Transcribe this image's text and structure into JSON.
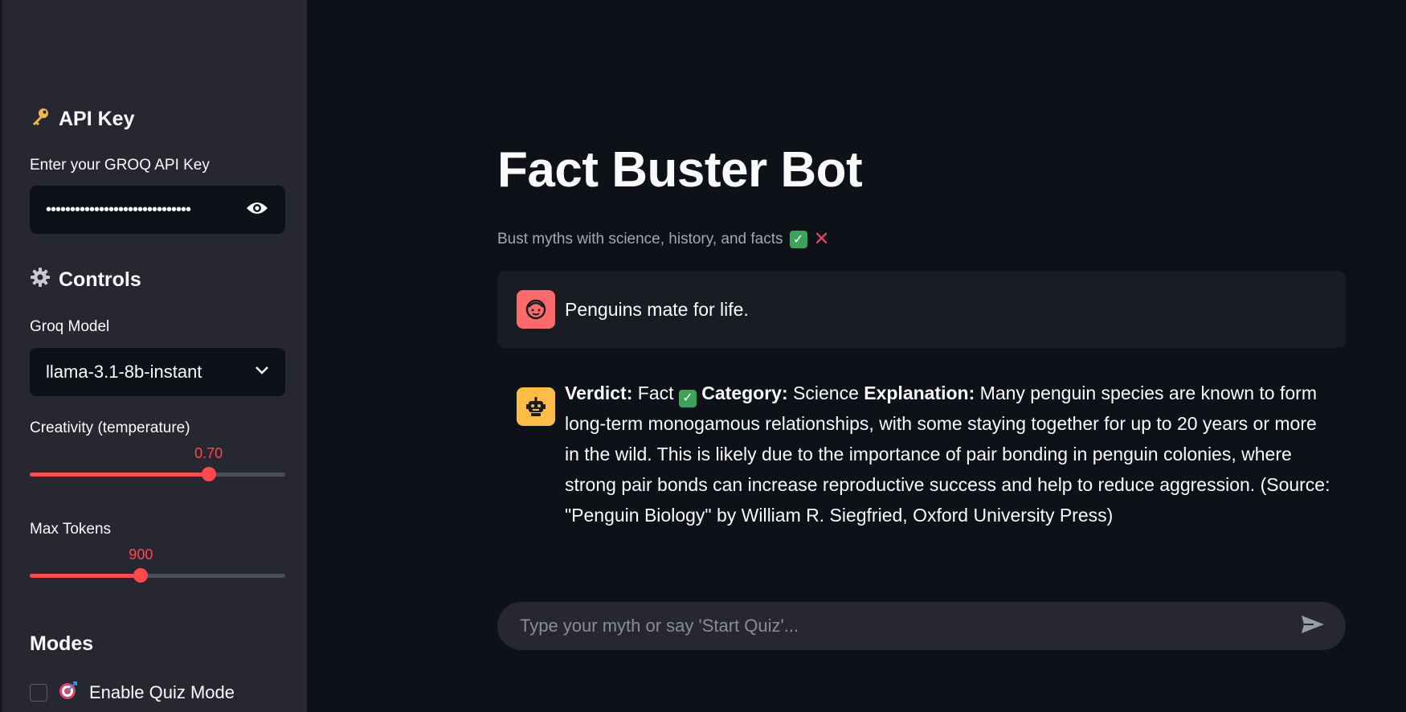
{
  "sidebar": {
    "api_heading": "API Key",
    "api_label": "Enter your GROQ API Key",
    "api_value": "••••••••••••••••••••••••••••••",
    "controls_heading": "Controls",
    "model_label": "Groq Model",
    "model_value": "llama-3.1-8b-instant",
    "temperature_label": "Creativity (temperature)",
    "temperature_value": "0.70",
    "temperature_fraction": 0.7,
    "tokens_label": "Max Tokens",
    "tokens_value": "900",
    "tokens_fraction": 0.435,
    "modes_heading": "Modes",
    "quiz_mode_label": "Enable Quiz Mode"
  },
  "main": {
    "title": "Fact Buster Bot",
    "subtitle": "Bust myths with science, history, and facts",
    "user_message": "Penguins mate for life.",
    "bot": {
      "verdict_label": "Verdict:",
      "verdict_value": "Fact",
      "category_label": "Category:",
      "category_value": "Science",
      "explanation_label": "Explanation:",
      "explanation_text": "Many penguin species are known to form long-term monogamous relationships, with some staying together for up to 20 years or more in the wild. This is likely due to the importance of pair bonding in penguin colonies, where strong pair bonds can increase reproductive success and help to reduce aggression. (Source: \"Penguin Biology\" by William R. Siegfried, Oxford University Press)"
    },
    "chat_placeholder": "Type your myth or say 'Start Quiz'..."
  },
  "colors": {
    "accent": "#ff4b4b",
    "background": "#0e1117",
    "sidebar": "#262730",
    "user_avatar": "#ff6b6b",
    "bot_avatar": "#ffbd45"
  },
  "icons": [
    "key-icon",
    "gear-icon",
    "eye-icon",
    "chevron-down-icon",
    "target-icon",
    "user-avatar-icon",
    "bot-avatar-icon",
    "send-icon",
    "check-icon",
    "cross-icon"
  ]
}
